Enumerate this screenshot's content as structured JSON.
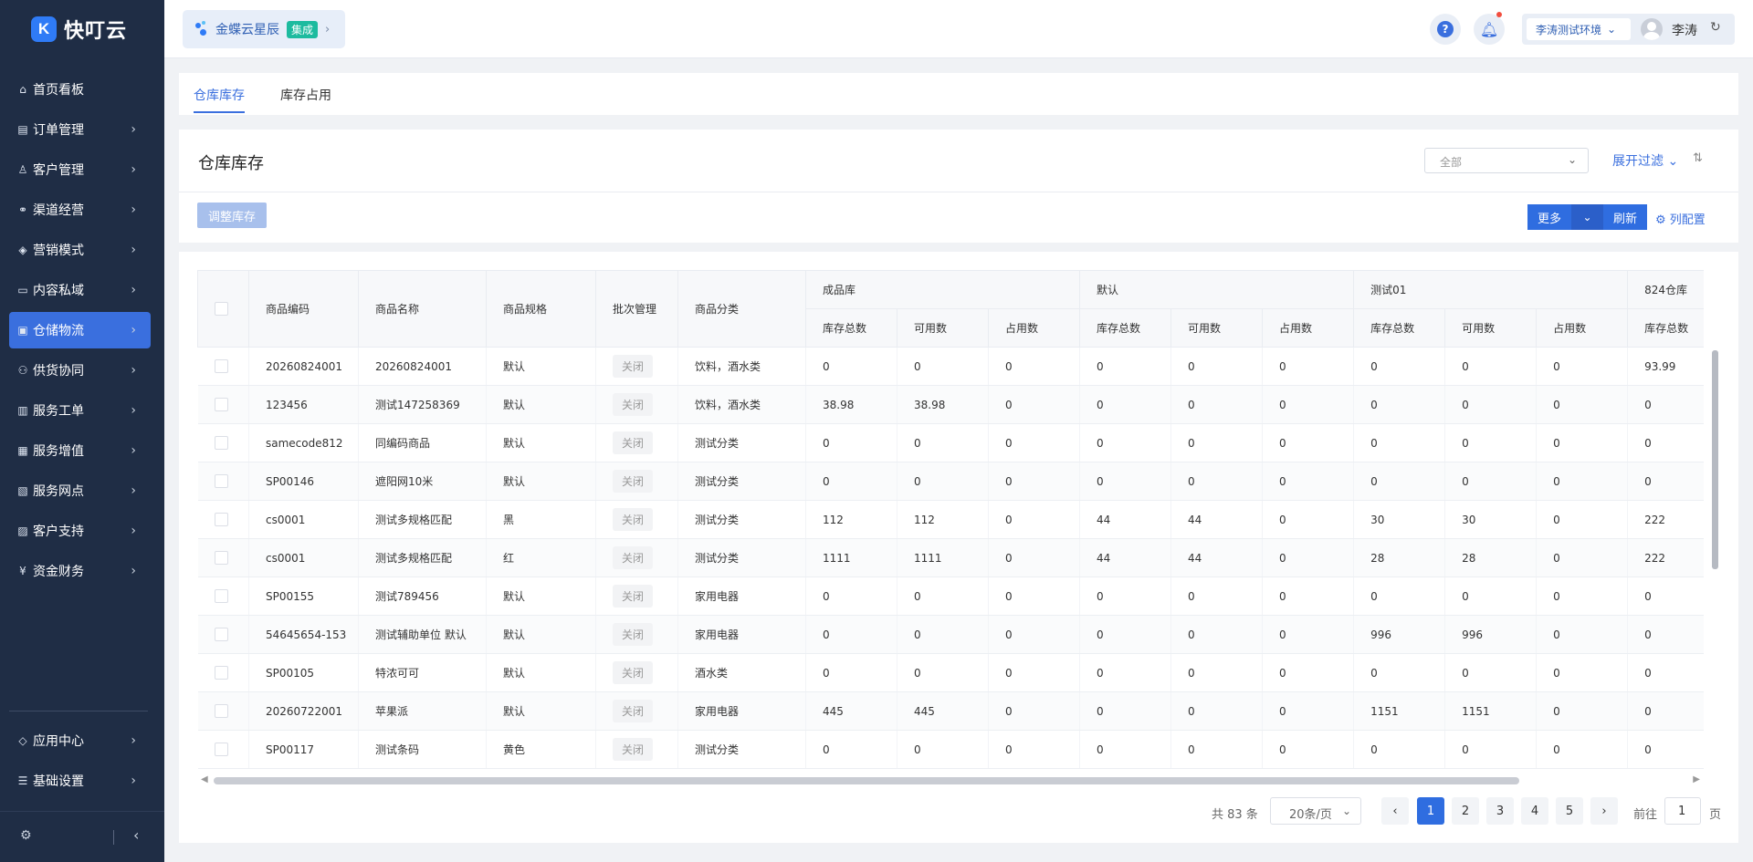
{
  "brand": {
    "name": "快叮云",
    "mark": "K"
  },
  "sidebar": {
    "items": [
      {
        "label": "首页看板",
        "icon": "home-icon",
        "glyph": "⌂",
        "chevron": false
      },
      {
        "label": "订单管理",
        "icon": "order-icon",
        "glyph": "▤",
        "chevron": true
      },
      {
        "label": "客户管理",
        "icon": "user-icon",
        "glyph": "♙",
        "chevron": true
      },
      {
        "label": "渠道经营",
        "icon": "channel-icon",
        "glyph": "⚭",
        "chevron": true
      },
      {
        "label": "营销模式",
        "icon": "tag-icon",
        "glyph": "◈",
        "chevron": true
      },
      {
        "label": "内容私域",
        "icon": "image-icon",
        "glyph": "▭",
        "chevron": true
      },
      {
        "label": "仓储物流",
        "icon": "warehouse-icon",
        "glyph": "▣",
        "chevron": true,
        "active": true
      },
      {
        "label": "供货协同",
        "icon": "supply-icon",
        "glyph": "⚇",
        "chevron": true
      },
      {
        "label": "服务工单",
        "icon": "ticket-icon",
        "glyph": "▥",
        "chevron": true
      },
      {
        "label": "服务增值",
        "icon": "bag-icon",
        "glyph": "▦",
        "chevron": true
      },
      {
        "label": "服务网点",
        "icon": "store-icon",
        "glyph": "▧",
        "chevron": true
      },
      {
        "label": "客户支持",
        "icon": "support-icon",
        "glyph": "▨",
        "chevron": true
      },
      {
        "label": "资金财务",
        "icon": "yuan-icon",
        "glyph": "¥",
        "chevron": true
      }
    ],
    "bottom": [
      {
        "label": "应用中心",
        "icon": "app-center-icon",
        "glyph": "◇",
        "chevron": true
      },
      {
        "label": "基础设置",
        "icon": "settings-list-icon",
        "glyph": "☰",
        "chevron": true
      }
    ]
  },
  "topbar": {
    "app_name": "金蝶云星辰",
    "app_tag": "集成",
    "env_label": "李涛测试环境",
    "user_name": "李涛"
  },
  "tabs": [
    {
      "label": "仓库库存",
      "active": true
    },
    {
      "label": "库存占用",
      "active": false
    }
  ],
  "header": {
    "title": "仓库库存",
    "scope_value": "全部",
    "expand_filter": "展开过滤",
    "adjust_button": "调整库存",
    "more_button": "更多",
    "refresh_button": "刷新",
    "column_config": "列配置"
  },
  "table": {
    "columns": [
      "商品编码",
      "商品名称",
      "商品规格",
      "批次管理",
      "商品分类"
    ],
    "warehouses": [
      "成品库",
      "默认",
      "测试01",
      "824仓库"
    ],
    "sub_columns": [
      "库存总数",
      "可用数",
      "占用数"
    ],
    "rows": [
      [
        "20260824001",
        "20260824001",
        "默认",
        "关闭",
        "饮料，酒水类",
        "0",
        "0",
        "0",
        "0",
        "0",
        "0",
        "0",
        "0",
        "0",
        "93.99"
      ],
      [
        "123456",
        "测试147258369",
        "默认",
        "关闭",
        "饮料，酒水类",
        "38.98",
        "38.98",
        "0",
        "0",
        "0",
        "0",
        "0",
        "0",
        "0",
        "0"
      ],
      [
        "samecode812",
        "同编码商品",
        "默认",
        "关闭",
        "测试分类",
        "0",
        "0",
        "0",
        "0",
        "0",
        "0",
        "0",
        "0",
        "0",
        "0"
      ],
      [
        "SP00146",
        "遮阳网10米",
        "默认",
        "关闭",
        "测试分类",
        "0",
        "0",
        "0",
        "0",
        "0",
        "0",
        "0",
        "0",
        "0",
        "0"
      ],
      [
        "cs0001",
        "测试多规格匹配",
        "黑",
        "关闭",
        "测试分类",
        "112",
        "112",
        "0",
        "44",
        "44",
        "0",
        "30",
        "30",
        "0",
        "222"
      ],
      [
        "cs0001",
        "测试多规格匹配",
        "红",
        "关闭",
        "测试分类",
        "1111",
        "1111",
        "0",
        "44",
        "44",
        "0",
        "28",
        "28",
        "0",
        "222"
      ],
      [
        "SP00155",
        "测试789456",
        "默认",
        "关闭",
        "家用电器",
        "0",
        "0",
        "0",
        "0",
        "0",
        "0",
        "0",
        "0",
        "0",
        "0"
      ],
      [
        "54645654-153",
        "测试辅助单位 默认",
        "默认",
        "关闭",
        "家用电器",
        "0",
        "0",
        "0",
        "0",
        "0",
        "0",
        "996",
        "996",
        "0",
        "0"
      ],
      [
        "SP00105",
        "特浓可可",
        "默认",
        "关闭",
        "酒水类",
        "0",
        "0",
        "0",
        "0",
        "0",
        "0",
        "0",
        "0",
        "0",
        "0"
      ],
      [
        "20260722001",
        "苹果派",
        "默认",
        "关闭",
        "家用电器",
        "445",
        "445",
        "0",
        "0",
        "0",
        "0",
        "1151",
        "1151",
        "0",
        "0"
      ],
      [
        "SP00117",
        "测试条码",
        "黄色",
        "关闭",
        "测试分类",
        "0",
        "0",
        "0",
        "0",
        "0",
        "0",
        "0",
        "0",
        "0",
        "0"
      ]
    ]
  },
  "pagination": {
    "total": "共 83 条",
    "page_size": "20条/页",
    "pages": [
      "1",
      "2",
      "3",
      "4",
      "5"
    ],
    "current": "1",
    "goto_label": "前往",
    "goto_value": "1",
    "page_suffix": "页"
  },
  "colors": {
    "primary": "#2f6de0",
    "sidebar_bg": "#1f2d45",
    "active_item": "#3a6fde"
  }
}
